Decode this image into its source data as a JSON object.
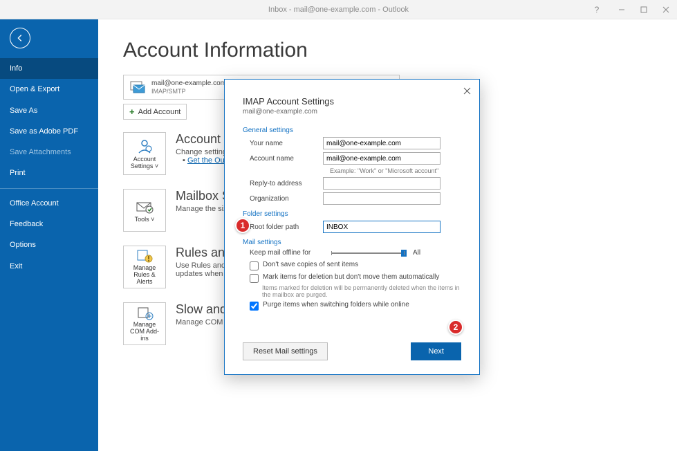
{
  "window": {
    "title": "Inbox - mail@one-example.com - Outlook",
    "help": "?"
  },
  "sidebar": {
    "items": [
      {
        "label": "Info",
        "active": true
      },
      {
        "label": "Open & Export"
      },
      {
        "label": "Save As"
      },
      {
        "label": "Save as Adobe PDF"
      },
      {
        "label": "Save Attachments",
        "disabled": true
      },
      {
        "label": "Print"
      }
    ],
    "items2": [
      {
        "label": "Office Account"
      },
      {
        "label": "Feedback"
      },
      {
        "label": "Options"
      },
      {
        "label": "Exit"
      }
    ]
  },
  "page": {
    "title": "Account Information",
    "account_email": "mail@one-example.com",
    "account_protocol": "IMAP/SMTP",
    "add_account": "Add Account",
    "sections": {
      "account_settings": {
        "tile": "Account Settings ˅",
        "title": "Account Settings",
        "desc": "Change settings for",
        "link": "Get the Outlook"
      },
      "mailbox": {
        "tile": "Tools ˅",
        "title": "Mailbox Settings",
        "desc": "Manage the size of"
      },
      "rules": {
        "tile": "Manage Rules & Alerts",
        "title": "Rules and Alerts",
        "desc1": "Use Rules and Alerts",
        "desc2": "updates when items"
      },
      "slow": {
        "tile": "Manage COM Add-ins",
        "title": "Slow and Disabled",
        "desc": "Manage COM add-in"
      }
    }
  },
  "dialog": {
    "title": "IMAP Account Settings",
    "subtitle": "mail@one-example.com",
    "general_head": "General settings",
    "your_name_label": "Your name",
    "your_name_value": "mail@one-example.com",
    "account_name_label": "Account name",
    "account_name_value": "mail@one-example.com",
    "account_name_hint": "Example: \"Work\" or \"Microsoft account\"",
    "reply_label": "Reply-to address",
    "reply_value": "",
    "org_label": "Organization",
    "org_value": "",
    "folder_head": "Folder settings",
    "root_label": "Root folder path",
    "root_value": "INBOX",
    "mail_head": "Mail settings",
    "keep_offline": "Keep mail offline for",
    "keep_offline_value": "All",
    "chk_dont_save": "Don't save copies of sent items",
    "chk_mark": "Mark items for deletion but don't move them automatically",
    "mark_note": "Items marked for deletion will be permanently deleted when the items in the mailbox are purged.",
    "chk_purge": "Purge items when switching folders while online",
    "reset_btn": "Reset Mail settings",
    "next_btn": "Next"
  },
  "annotations": {
    "one": "1",
    "two": "2"
  }
}
